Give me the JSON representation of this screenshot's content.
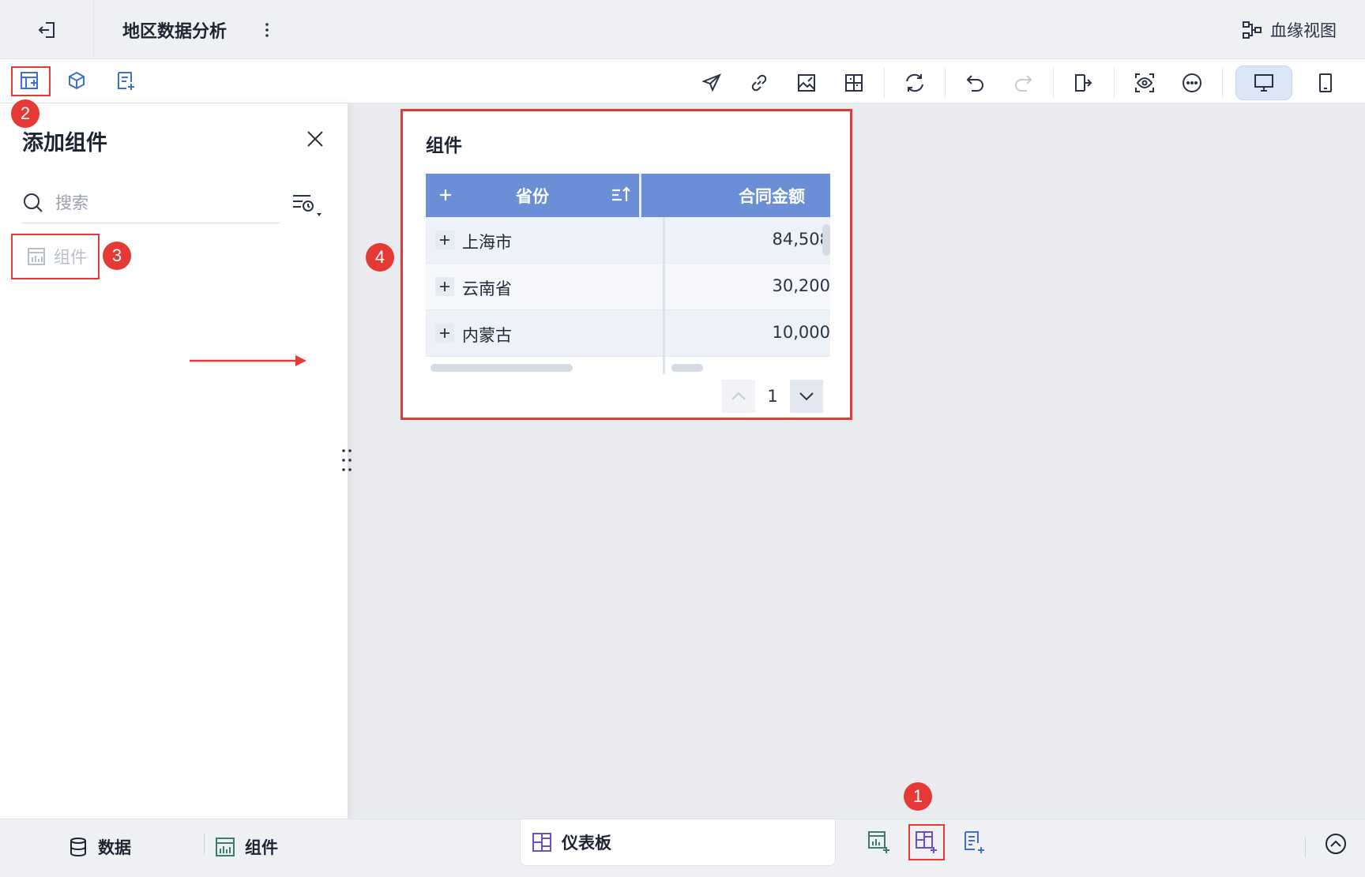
{
  "titlebar": {
    "title": "地区数据分析",
    "lineage_label": "血缘视图"
  },
  "panel": {
    "title": "添加组件",
    "search_placeholder": "搜索",
    "items": [
      {
        "label": "组件"
      }
    ]
  },
  "widget": {
    "title": "组件",
    "columns": [
      "省份",
      "合同金额"
    ],
    "rows": [
      {
        "province": "上海市",
        "amount": "84,508"
      },
      {
        "province": "云南省",
        "amount": "30,200"
      },
      {
        "province": "内蒙古",
        "amount": "10,000"
      }
    ],
    "page": "1"
  },
  "bottombar": {
    "data_label": "数据",
    "component_label": "组件",
    "dashboard_label": "仪表板"
  },
  "badges": [
    "1",
    "2",
    "3",
    "4"
  ],
  "colors": {
    "accent": "#3d6fd6",
    "header_blue": "#6a8fd6",
    "annotation_red": "#e53935",
    "canvas_gray": "#e9ebef"
  }
}
